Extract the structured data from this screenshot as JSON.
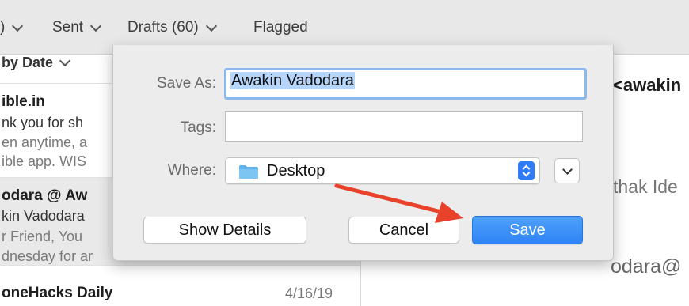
{
  "favorites_bar": {
    "mailboxes_partial": ")",
    "sent": "Sent",
    "drafts": "Drafts (60)",
    "flagged": "Flagged"
  },
  "message_list": {
    "sort_label": "by Date",
    "messages": [
      {
        "sender": "ible.in",
        "line1": "nk you for sh",
        "line2": "en anytime, a",
        "line3": "ible app. WIS",
        "date": ""
      },
      {
        "sender": "odara @ Aw",
        "line1": "kin Vadodara",
        "line2": "r Friend, You",
        "line3": "dnesday for ar",
        "date": ""
      },
      {
        "sender": "oneHacks Daily",
        "line1": "",
        "line2": "",
        "line3": "",
        "date": "4/16/19"
      }
    ]
  },
  "detail_pane": {
    "from_partial": "<awakin",
    "name_partial": "thak Ide",
    "email_partial": "odara@"
  },
  "save_dialog": {
    "save_as_label": "Save As:",
    "save_as_value": "Awakin Vadodara",
    "tags_label": "Tags:",
    "tags_value": "",
    "where_label": "Where:",
    "where_value": "Desktop",
    "show_details_label": "Show Details",
    "cancel_label": "Cancel",
    "save_label": "Save"
  },
  "icons": {
    "folder": "folder-icon",
    "stepper": "up-down-stepper-icon",
    "disclosure": "chevron-down-icon",
    "annotation": "red-arrow"
  },
  "colors": {
    "accent": "#2f84f5",
    "selection": "#b5d5fb",
    "focus_ring": "#8db8ef",
    "arrow": "#e8432a"
  }
}
